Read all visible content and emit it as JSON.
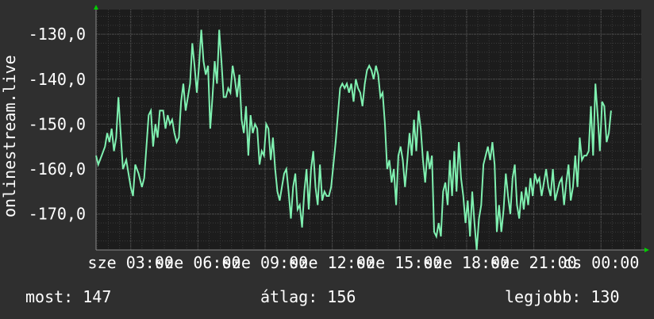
{
  "chart_data": {
    "type": "line",
    "ylabel": "onlinestream.live",
    "xlabel": "",
    "ylim": [
      -178,
      -124.5
    ],
    "yticks": [
      -130,
      -140,
      -150,
      -160,
      -170
    ],
    "ytick_labels": [
      "-130,0",
      "-140,0",
      "-150,0",
      "-160,0",
      "-170,0"
    ],
    "xlim": [
      1.45,
      25.8
    ],
    "xticks": [
      3,
      6,
      9,
      12,
      15,
      18,
      21,
      24
    ],
    "xtick_labels": [
      "sze 03:00",
      "sze 06:00",
      "sze 09:00",
      "sze 12:00",
      "sze 15:00",
      "sze 18:00",
      "sze 21:00",
      "cs 00:00"
    ],
    "grid": true,
    "colors": {
      "background": "#2f2f2f",
      "plot_area": "#1c1c1c",
      "grid": "#4a4a4a",
      "line": "#7ff0b0",
      "arrow": "#00cc00",
      "text": "#ffffff"
    },
    "series": [
      {
        "values": [
          [
            1.45,
            -157
          ],
          [
            1.55,
            -159
          ],
          [
            1.7,
            -157
          ],
          [
            1.85,
            -155
          ],
          [
            1.95,
            -152
          ],
          [
            2.05,
            -154
          ],
          [
            2.15,
            -151
          ],
          [
            2.25,
            -156
          ],
          [
            2.35,
            -153
          ],
          [
            2.45,
            -144
          ],
          [
            2.55,
            -152
          ],
          [
            2.65,
            -160
          ],
          [
            2.8,
            -158
          ],
          [
            2.9,
            -161
          ],
          [
            3.0,
            -164
          ],
          [
            3.1,
            -166
          ],
          [
            3.2,
            -159
          ],
          [
            3.35,
            -161
          ],
          [
            3.5,
            -164
          ],
          [
            3.6,
            -162
          ],
          [
            3.7,
            -155
          ],
          [
            3.8,
            -148
          ],
          [
            3.9,
            -147
          ],
          [
            4.0,
            -155
          ],
          [
            4.1,
            -150
          ],
          [
            4.2,
            -153
          ],
          [
            4.3,
            -147
          ],
          [
            4.45,
            -147
          ],
          [
            4.55,
            -151
          ],
          [
            4.65,
            -148
          ],
          [
            4.75,
            -150
          ],
          [
            4.85,
            -149
          ],
          [
            4.95,
            -152
          ],
          [
            5.05,
            -154
          ],
          [
            5.15,
            -153
          ],
          [
            5.25,
            -145
          ],
          [
            5.35,
            -141
          ],
          [
            5.45,
            -147
          ],
          [
            5.55,
            -144
          ],
          [
            5.65,
            -141
          ],
          [
            5.75,
            -132
          ],
          [
            5.85,
            -137
          ],
          [
            5.95,
            -143
          ],
          [
            6.05,
            -137
          ],
          [
            6.15,
            -129
          ],
          [
            6.25,
            -136
          ],
          [
            6.35,
            -139
          ],
          [
            6.45,
            -137
          ],
          [
            6.55,
            -151
          ],
          [
            6.65,
            -144
          ],
          [
            6.75,
            -136
          ],
          [
            6.85,
            -141
          ],
          [
            6.95,
            -129
          ],
          [
            7.05,
            -136
          ],
          [
            7.15,
            -144
          ],
          [
            7.25,
            -144
          ],
          [
            7.35,
            -142
          ],
          [
            7.45,
            -143
          ],
          [
            7.55,
            -137
          ],
          [
            7.65,
            -140
          ],
          [
            7.75,
            -144
          ],
          [
            7.85,
            -139
          ],
          [
            7.95,
            -149
          ],
          [
            8.05,
            -152
          ],
          [
            8.15,
            -146
          ],
          [
            8.25,
            -157
          ],
          [
            8.35,
            -148
          ],
          [
            8.45,
            -152
          ],
          [
            8.55,
            -150
          ],
          [
            8.65,
            -151
          ],
          [
            8.75,
            -159
          ],
          [
            8.85,
            -156
          ],
          [
            8.95,
            -157
          ],
          [
            9.05,
            -150
          ],
          [
            9.15,
            -151
          ],
          [
            9.25,
            -158
          ],
          [
            9.35,
            -153
          ],
          [
            9.45,
            -160
          ],
          [
            9.55,
            -165
          ],
          [
            9.65,
            -167
          ],
          [
            9.75,
            -164
          ],
          [
            9.85,
            -161
          ],
          [
            9.95,
            -160
          ],
          [
            10.05,
            -165
          ],
          [
            10.15,
            -171
          ],
          [
            10.25,
            -164
          ],
          [
            10.35,
            -161
          ],
          [
            10.45,
            -169
          ],
          [
            10.55,
            -168
          ],
          [
            10.65,
            -173
          ],
          [
            10.75,
            -165
          ],
          [
            10.85,
            -160
          ],
          [
            10.95,
            -169
          ],
          [
            11.05,
            -160
          ],
          [
            11.15,
            -156
          ],
          [
            11.25,
            -164
          ],
          [
            11.35,
            -168
          ],
          [
            11.45,
            -159
          ],
          [
            11.55,
            -167
          ],
          [
            11.65,
            -165
          ],
          [
            11.75,
            -166
          ],
          [
            11.85,
            -166
          ],
          [
            11.95,
            -164
          ],
          [
            12.05,
            -159
          ],
          [
            12.15,
            -154
          ],
          [
            12.25,
            -148
          ],
          [
            12.35,
            -142
          ],
          [
            12.45,
            -141
          ],
          [
            12.55,
            -142
          ],
          [
            12.65,
            -141
          ],
          [
            12.75,
            -143
          ],
          [
            12.85,
            -141
          ],
          [
            12.95,
            -145
          ],
          [
            13.05,
            -140
          ],
          [
            13.15,
            -142
          ],
          [
            13.25,
            -143
          ],
          [
            13.35,
            -146
          ],
          [
            13.45,
            -141
          ],
          [
            13.55,
            -138
          ],
          [
            13.65,
            -137
          ],
          [
            13.75,
            -138
          ],
          [
            13.85,
            -140
          ],
          [
            13.95,
            -137
          ],
          [
            14.05,
            -139
          ],
          [
            14.15,
            -144
          ],
          [
            14.25,
            -143
          ],
          [
            14.35,
            -150
          ],
          [
            14.45,
            -160
          ],
          [
            14.55,
            -158
          ],
          [
            14.65,
            -163
          ],
          [
            14.75,
            -160
          ],
          [
            14.85,
            -168
          ],
          [
            14.95,
            -157
          ],
          [
            15.05,
            -155
          ],
          [
            15.15,
            -158
          ],
          [
            15.25,
            -164
          ],
          [
            15.35,
            -158
          ],
          [
            15.45,
            -152
          ],
          [
            15.55,
            -157
          ],
          [
            15.65,
            -149
          ],
          [
            15.75,
            -156
          ],
          [
            15.85,
            -147
          ],
          [
            15.95,
            -151
          ],
          [
            16.05,
            -158
          ],
          [
            16.15,
            -163
          ],
          [
            16.25,
            -156
          ],
          [
            16.35,
            -160
          ],
          [
            16.45,
            -157
          ],
          [
            16.55,
            -174
          ],
          [
            16.65,
            -175
          ],
          [
            16.75,
            -172
          ],
          [
            16.85,
            -175
          ],
          [
            16.95,
            -165
          ],
          [
            17.05,
            -163
          ],
          [
            17.15,
            -168
          ],
          [
            17.25,
            -158
          ],
          [
            17.35,
            -166
          ],
          [
            17.45,
            -156
          ],
          [
            17.55,
            -165
          ],
          [
            17.65,
            -154
          ],
          [
            17.75,
            -162
          ],
          [
            17.85,
            -166
          ],
          [
            17.95,
            -172
          ],
          [
            18.05,
            -167
          ],
          [
            18.15,
            -175
          ],
          [
            18.25,
            -165
          ],
          [
            18.35,
            -172
          ],
          [
            18.45,
            -178
          ],
          [
            18.55,
            -171
          ],
          [
            18.65,
            -168
          ],
          [
            18.75,
            -159
          ],
          [
            18.85,
            -157
          ],
          [
            18.95,
            -155
          ],
          [
            19.05,
            -158
          ],
          [
            19.15,
            -154
          ],
          [
            19.25,
            -159
          ],
          [
            19.35,
            -174
          ],
          [
            19.45,
            -168
          ],
          [
            19.55,
            -174
          ],
          [
            19.65,
            -169
          ],
          [
            19.75,
            -161
          ],
          [
            19.85,
            -166
          ],
          [
            19.95,
            -170
          ],
          [
            20.05,
            -162
          ],
          [
            20.15,
            -159
          ],
          [
            20.25,
            -168
          ],
          [
            20.35,
            -171
          ],
          [
            20.45,
            -165
          ],
          [
            20.55,
            -169
          ],
          [
            20.65,
            -164
          ],
          [
            20.75,
            -168
          ],
          [
            20.85,
            -162
          ],
          [
            20.95,
            -166
          ],
          [
            21.05,
            -161
          ],
          [
            21.15,
            -163
          ],
          [
            21.25,
            -162
          ],
          [
            21.35,
            -166
          ],
          [
            21.45,
            -163
          ],
          [
            21.55,
            -160
          ],
          [
            21.65,
            -164
          ],
          [
            21.75,
            -166
          ],
          [
            21.85,
            -160
          ],
          [
            21.95,
            -167
          ],
          [
            22.05,
            -165
          ],
          [
            22.15,
            -163
          ],
          [
            22.25,
            -162
          ],
          [
            22.35,
            -168
          ],
          [
            22.45,
            -163
          ],
          [
            22.55,
            -159
          ],
          [
            22.65,
            -167
          ],
          [
            22.75,
            -164
          ],
          [
            22.85,
            -157
          ],
          [
            22.95,
            -164
          ],
          [
            23.05,
            -153
          ],
          [
            23.15,
            -158
          ],
          [
            23.25,
            -157
          ],
          [
            23.35,
            -157
          ],
          [
            23.45,
            -156
          ],
          [
            23.55,
            -146
          ],
          [
            23.65,
            -157
          ],
          [
            23.75,
            -141
          ],
          [
            23.85,
            -148
          ],
          [
            23.95,
            -156
          ],
          [
            24.05,
            -145
          ],
          [
            24.15,
            -146
          ],
          [
            24.25,
            -154
          ],
          [
            24.35,
            -152
          ],
          [
            24.45,
            -147
          ]
        ]
      }
    ]
  },
  "stats": {
    "now": "most: 147",
    "avg": "átlag: 156",
    "best": "legjobb: 130"
  }
}
